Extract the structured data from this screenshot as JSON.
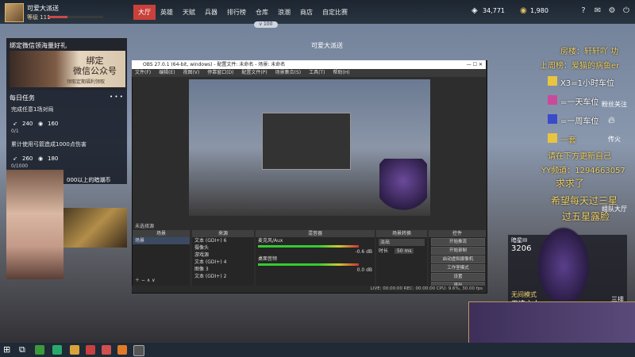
{
  "player": {
    "name": "可爱大派送",
    "level": "等级 111"
  },
  "nav": [
    "大厅",
    "英雄",
    "天赋",
    "兵器",
    "排行榜",
    "仓库",
    "浪潮",
    "商店",
    "自定比赛"
  ],
  "currency": {
    "gems": "34,771",
    "gold": "1,980"
  },
  "version_tag": "v 100",
  "center_title": "可爱大派送",
  "bind_panel": {
    "title": "绑定微信领海量好礼",
    "image_text": "绑定\n微信公众号",
    "image_sub": "领取定期福利领取"
  },
  "daily_task": {
    "title": "每日任务",
    "more": "• • •",
    "tasks": [
      {
        "label": "完成任意1场对局",
        "progress": "0/1",
        "reward_a": "240",
        "reward_b": "160"
      },
      {
        "label": "累计使用弓箭造成1000点伤害",
        "progress": "0/1000",
        "reward_a": "260",
        "reward_b": "180"
      }
    ],
    "webcam_caption": "000以上的暗潮币"
  },
  "obs": {
    "title": "OBS 27.0.1 (64-bit, windows) - 配置文件: 未命名 - 场景: 未命名",
    "menu": [
      "文件(F)",
      "编辑(E)",
      "视图(V)",
      "停靠窗口(D)",
      "配置文件(P)",
      "场景集合(S)",
      "工具(T)",
      "帮助(H)"
    ],
    "scene_bar": "未选择源",
    "panel_headers": [
      "场景",
      "来源",
      "混音器",
      "场景转换",
      "控件"
    ],
    "scenes": [
      "场景"
    ],
    "sources": [
      "文本 (GDI+) 6",
      "摄像头",
      "游戏源",
      "文本 (GDI+) 4",
      "图像 3",
      "文本 (GDI+) 2"
    ],
    "mixer": [
      {
        "name": "麦克风/Aux",
        "db": "-0.6 dB"
      },
      {
        "name": "桌面音频",
        "db": "0.0 dB"
      }
    ],
    "transition": {
      "type": "淡出",
      "duration_label": "时长",
      "duration": "50 ms"
    },
    "controls": [
      "开始推流",
      "开始录制",
      "启动虚拟摄像机",
      "工作室模式",
      "设置",
      "退出"
    ],
    "status": "LIVE: 00:00:00   REC: 00:00:00   CPU: 9.6%, 30.00 fps"
  },
  "chat": [
    {
      "text": "房楼：轩轩吖 功",
      "color": "#f2d36a"
    },
    {
      "text": "上周榜：爱猫的病鱼er",
      "color": "#f2d36a"
    },
    {
      "text": "X3=1小时车位",
      "color": "#ffffff"
    },
    {
      "text": "=一天车位",
      "color": "#ffffff"
    },
    {
      "text": "=一周车位",
      "color": "#ffffff"
    },
    {
      "text": "一套",
      "color": "#f2d36a"
    },
    {
      "text": "请在下方更新自己",
      "color": "#f2d36a"
    },
    {
      "text": "YY频道：1294663057",
      "color": "#f2d36a"
    },
    {
      "text": "求求了",
      "color": "#f2d36a"
    },
    {
      "text": "希望每天过三星",
      "color": "#f2d36a"
    },
    {
      "text": "过五星露脸",
      "color": "#f2d36a"
    }
  ],
  "side_labels": [
    "粉丝关注",
    "传火",
    "组队大厅"
  ],
  "info_box": {
    "title": "暗星III",
    "score": "3206",
    "mode": "无间模式",
    "mode_sub": "天选之人",
    "right_label": "三排"
  }
}
